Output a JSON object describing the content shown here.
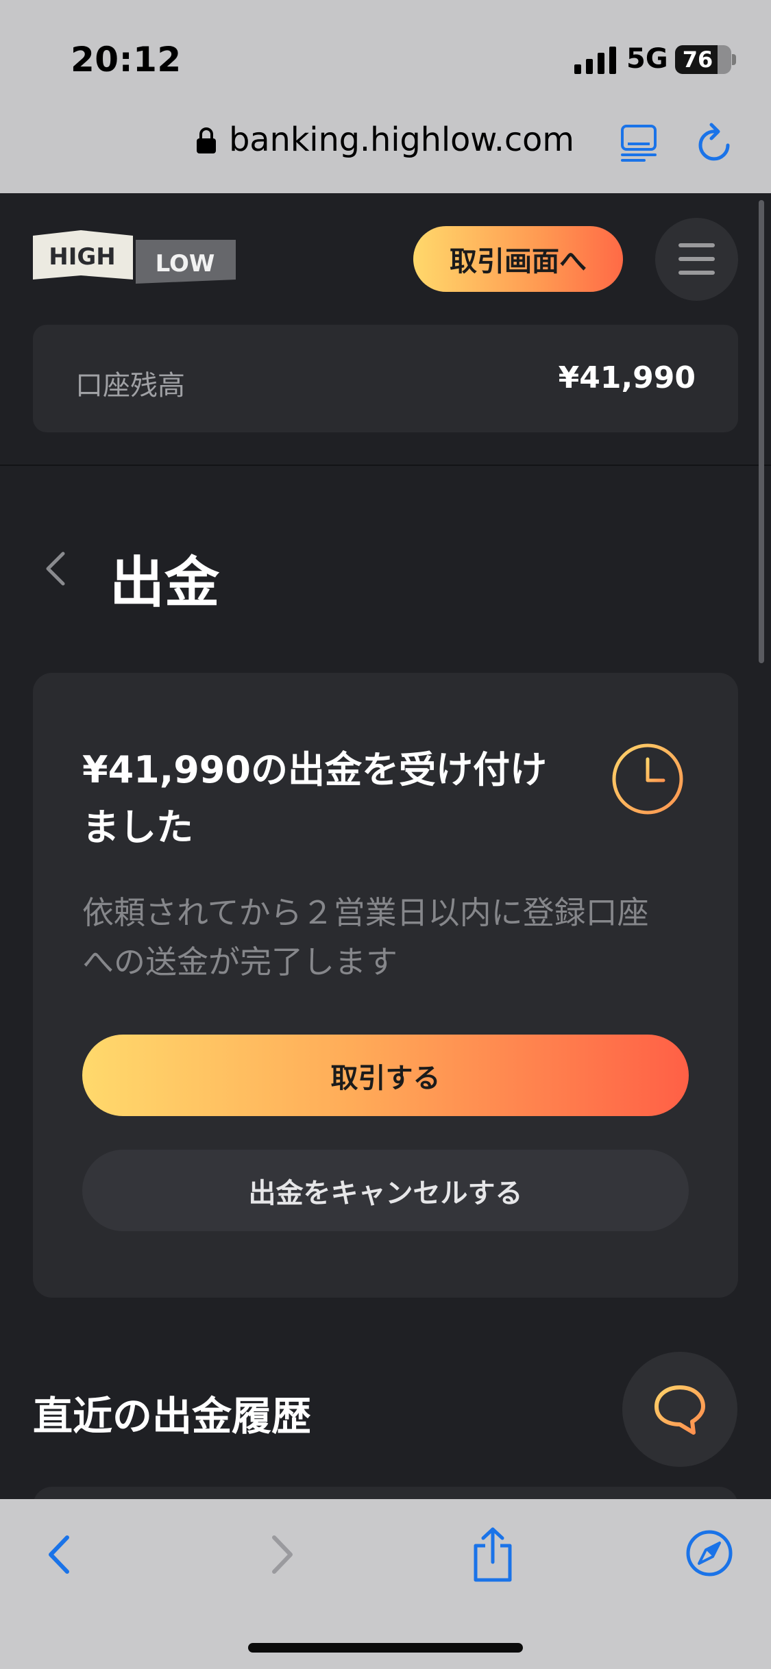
{
  "status_bar": {
    "time": "20:12",
    "network": "5G",
    "battery": "76"
  },
  "address_bar": {
    "url": "banking.highlow.com"
  },
  "header": {
    "logo_high": "HIGH",
    "logo_low": "LOW",
    "trade_screen_button": "取引画面へ"
  },
  "balance": {
    "label": "口座残高",
    "value": "¥41,990"
  },
  "page": {
    "title": "出金"
  },
  "withdrawal_card": {
    "title_line1": "¥41,990の出金を受け付け",
    "title_line2": "ました",
    "desc_line1": "依頼されてから２営業日以内に登録口座",
    "desc_line2": "への送金が完了します",
    "trade_button": "取引する",
    "cancel_button": "出金をキャンセルする"
  },
  "history": {
    "title": "直近の出金履歴"
  },
  "colors": {
    "background": "#1f2024",
    "card": "#2a2b2f",
    "accent_start": "#ffd96c",
    "accent_end": "#ff6046",
    "ios_blue": "#1a73e8"
  },
  "icons": [
    "lock-icon",
    "reader-icon",
    "reload-icon",
    "hamburger-icon",
    "back-chevron-icon",
    "clock-icon",
    "chat-icon",
    "toolbar-back-icon",
    "toolbar-forward-icon",
    "share-icon",
    "compass-icon"
  ]
}
